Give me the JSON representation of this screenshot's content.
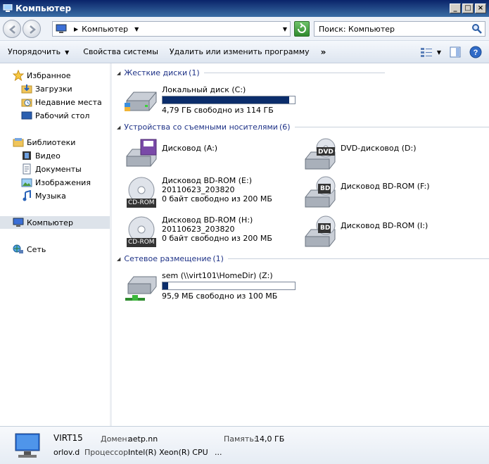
{
  "window": {
    "title": "Компьютер"
  },
  "address": {
    "crumb": "Компьютер"
  },
  "search": {
    "placeholder": "Поиск: Компьютер"
  },
  "toolbar": {
    "organize": "Упорядочить",
    "system_properties": "Свойства системы",
    "uninstall": "Удалить или изменить программу",
    "more": "»"
  },
  "nav": {
    "favorites": "Избранное",
    "downloads": "Загрузки",
    "recent": "Недавние места",
    "desktop": "Рабочий стол",
    "libraries": "Библиотеки",
    "video": "Видео",
    "documents": "Документы",
    "pictures": "Изображения",
    "music": "Музыка",
    "computer": "Компьютер",
    "network": "Сеть"
  },
  "groups": {
    "hard": {
      "label": "Жесткие диски",
      "count": "(1)"
    },
    "removable": {
      "label": "Устройства со съемными носителями",
      "count": "(6)"
    },
    "network": {
      "label": "Сетевое размещение",
      "count": "(1)"
    }
  },
  "drives": {
    "c": {
      "name": "Локальный диск (C:)",
      "free": "4,79 ГБ свободно из 114 ГБ",
      "used_fraction": 0.958
    },
    "a": {
      "name": "Дисковод (A:)"
    },
    "d": {
      "name": "DVD-дисковод (D:)",
      "badge": "DVD"
    },
    "e": {
      "name": "Дисковод BD-ROM (E:)",
      "label": "20110623_203820",
      "free": "0 байт свободно из 200 МБ",
      "badge": "CD-ROM"
    },
    "f": {
      "name": "Дисковод BD-ROM (F:)",
      "badge": "BD"
    },
    "h": {
      "name": "Дисковод BD-ROM (H:)",
      "label": "20110623_203820",
      "free": "0 байт свободно из 200 МБ",
      "badge": "CD-ROM"
    },
    "i": {
      "name": "Дисковод BD-ROM (I:)",
      "badge": "BD"
    },
    "z": {
      "name": "sem (\\\\virt101\\HomeDir) (Z:)",
      "free": "95,9 МБ свободно из 100 МБ",
      "used_fraction": 0.041
    }
  },
  "details": {
    "computer_name": "VIRT15",
    "user": "orlov.d",
    "domain_label": "Домен:",
    "domain_value": "aetp.nn",
    "memory_label": "Память:",
    "memory_value": "14,0 ГБ",
    "cpu_label": "Процессор:",
    "cpu_value": "Intel(R) Xeon(R) CPU",
    "ellipsis": "..."
  }
}
